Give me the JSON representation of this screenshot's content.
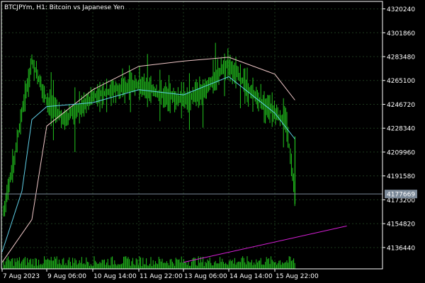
{
  "title": "BTCJPYm, H1:  Bitcoin vs Japanese Yen",
  "current_price_label": "4177669",
  "colors": {
    "background": "#000000",
    "grid": "#1e3a1e",
    "axis": "#ffffff",
    "bars": "#22c51e",
    "ma_fast": "#5fd0e8",
    "ma_slow": "#f0c8c8",
    "trend_line": "#d61fd6",
    "price_line": "#7c8a99",
    "volume": "#22c51e"
  },
  "chart_data": {
    "type": "line",
    "symbol": "BTCJPYm",
    "timeframe": "H1",
    "description": "Bitcoin vs Japanese Yen",
    "y_ticks": [
      4320240,
      4301860,
      4283480,
      4265100,
      4246720,
      4228340,
      4209960,
      4191580,
      4173200,
      4154820,
      4136440
    ],
    "x_ticks": [
      "7 Aug 2023",
      "9 Aug 06:00",
      "10 Aug 14:00",
      "11 Aug 22:00",
      "13 Aug 06:00",
      "14 Aug 14:00",
      "15 Aug 22:00"
    ],
    "ylim": [
      4120000,
      4326000
    ],
    "current_price": 4177669,
    "close_series": [
      {
        "x": "7 Aug 2023",
        "y": 4160000
      },
      {
        "x": "7 Aug 12:00",
        "y": 4195000
      },
      {
        "x": "8 Aug 00:00",
        "y": 4240000
      },
      {
        "x": "8 Aug 12:00",
        "y": 4280000
      },
      {
        "x": "9 Aug 06:00",
        "y": 4250000
      },
      {
        "x": "9 Aug 18:00",
        "y": 4235000
      },
      {
        "x": "10 Aug 06:00",
        "y": 4245000
      },
      {
        "x": "10 Aug 14:00",
        "y": 4252000
      },
      {
        "x": "11 Aug 04:00",
        "y": 4258000
      },
      {
        "x": "11 Aug 22:00",
        "y": 4262000
      },
      {
        "x": "12 Aug 12:00",
        "y": 4255000
      },
      {
        "x": "13 Aug 06:00",
        "y": 4250000
      },
      {
        "x": "13 Aug 20:00",
        "y": 4256000
      },
      {
        "x": "14 Aug 06:00",
        "y": 4270000
      },
      {
        "x": "14 Aug 14:00",
        "y": 4278000
      },
      {
        "x": "15 Aug 06:00",
        "y": 4255000
      },
      {
        "x": "15 Aug 22:00",
        "y": 4240000
      },
      {
        "x": "16 Aug 06:00",
        "y": 4232000
      },
      {
        "x": "16 Aug 12:00",
        "y": 4177669
      }
    ],
    "ma_fast": [
      {
        "x": "7 Aug 2023",
        "y": 4133000
      },
      {
        "x": "8 Aug 00:00",
        "y": 4180000
      },
      {
        "x": "8 Aug 12:00",
        "y": 4235000
      },
      {
        "x": "9 Aug 06:00",
        "y": 4245000
      },
      {
        "x": "10 Aug 14:00",
        "y": 4248000
      },
      {
        "x": "11 Aug 22:00",
        "y": 4258000
      },
      {
        "x": "13 Aug 06:00",
        "y": 4254000
      },
      {
        "x": "14 Aug 14:00",
        "y": 4268000
      },
      {
        "x": "15 Aug 22:00",
        "y": 4240000
      },
      {
        "x": "16 Aug 12:00",
        "y": 4220000
      }
    ],
    "ma_slow": [
      {
        "x": "7 Aug 2023",
        "y": 4125000
      },
      {
        "x": "8 Aug 12:00",
        "y": 4158000
      },
      {
        "x": "9 Aug 06:00",
        "y": 4230000
      },
      {
        "x": "10 Aug 14:00",
        "y": 4258000
      },
      {
        "x": "11 Aug 22:00",
        "y": 4276000
      },
      {
        "x": "13 Aug 06:00",
        "y": 4280000
      },
      {
        "x": "14 Aug 14:00",
        "y": 4283000
      },
      {
        "x": "15 Aug 22:00",
        "y": 4270000
      },
      {
        "x": "16 Aug 12:00",
        "y": 4250000
      }
    ],
    "trend_line": [
      {
        "x": "13 Aug 06:00",
        "y": 4125000
      },
      {
        "x": "18 Aug",
        "y": 4153000
      }
    ],
    "grid": true,
    "indicators": [
      "moving average (fast)",
      "moving average (slow)",
      "volume",
      "trend line"
    ]
  }
}
